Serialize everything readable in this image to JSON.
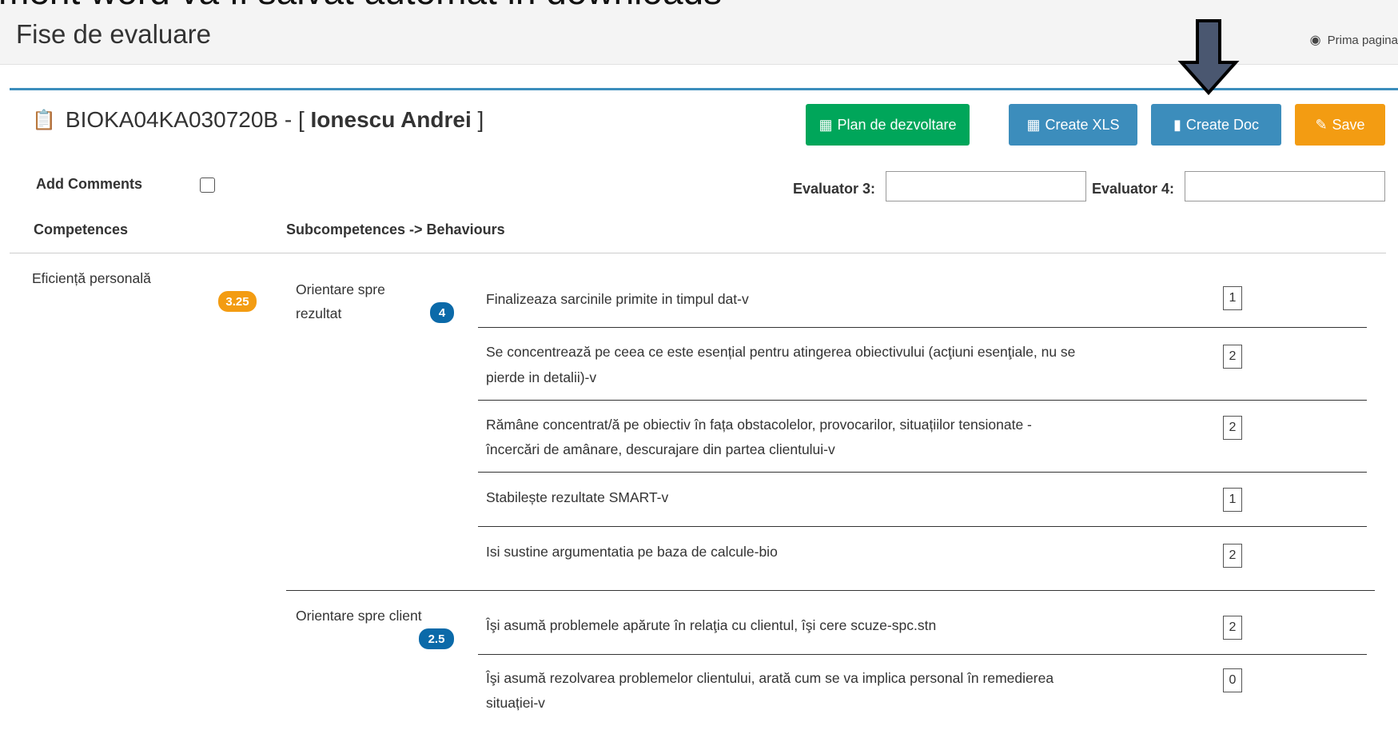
{
  "caption": "ment word va fi salvat automat in downloads",
  "header": {
    "page_title": "Fise de evaluare",
    "home_label": "Prima pagina",
    "home_icon": "dashboard-icon"
  },
  "document": {
    "code": "BIOKA04KA030720B - [ ",
    "name": "Ionescu Andrei",
    "close": " ]",
    "icon": "clipboard-icon"
  },
  "buttons": {
    "plan": "Plan de dezvoltare",
    "xls": "Create XLS",
    "doc": "Create Doc",
    "save": "Save"
  },
  "colors": {
    "green": "#00a65a",
    "blue": "#3c8dbc",
    "orange": "#f39c12",
    "badge_blue": "#0b6aa9"
  },
  "form": {
    "add_comments": "Add Comments",
    "evaluator3": "Evaluator 3:",
    "evaluator4": "Evaluator 4:"
  },
  "columns": {
    "competences": "Competences",
    "subcompetences": "Subcompetences -> Behaviours"
  },
  "competence": {
    "name": "Eficiență personală",
    "score": "3.25"
  },
  "subcompetences": [
    {
      "name_line1": "Orientare spre",
      "name_line2": "rezultat",
      "score": "4",
      "behaviours": [
        {
          "line1": "Finalizeaza sarcinile primite in timpul dat-v",
          "line2": "",
          "value": "1"
        },
        {
          "line1": "Se concentrează pe ceea ce este esențial pentru atingerea obiectivului (acţiuni esenţiale, nu se",
          "line2": "pierde in detalii)-v",
          "value": "2"
        },
        {
          "line1": "Rămâne concentrat/ă pe obiectiv în fața obstacolelor, provocarilor, situațiilor tensionate -",
          "line2": "încercări de amânare, descurajare din partea clientului-v",
          "value": "2"
        },
        {
          "line1": "Stabilește rezultate SMART-v",
          "line2": "",
          "value": "1"
        },
        {
          "line1": "Isi sustine argumentatia pe baza de calcule-bio",
          "line2": "",
          "value": "2"
        }
      ]
    },
    {
      "name_line1": "Orientare spre client",
      "name_line2": "",
      "score": "2.5",
      "behaviours": [
        {
          "line1": "Îşi asumă problemele apărute în relaţia cu clientul, îşi cere scuze-spc.stn",
          "line2": "",
          "value": "2"
        },
        {
          "line1": "Îşi asumă rezolvarea problemelor clientului, arată cum se va implica personal în remedierea",
          "line2": "situației-v",
          "value": "0"
        }
      ]
    }
  ]
}
